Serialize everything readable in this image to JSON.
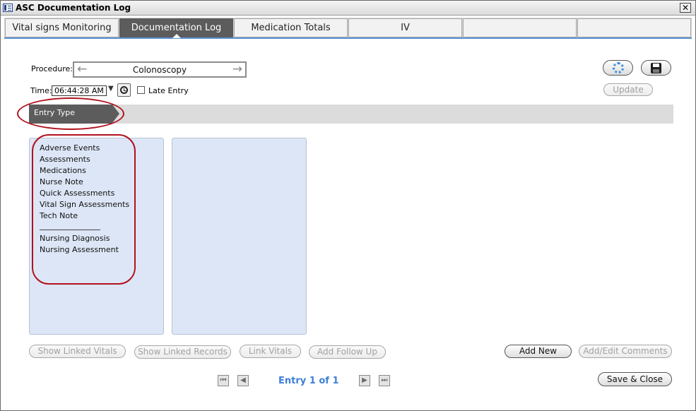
{
  "window": {
    "title": "ASC Documentation Log",
    "close_glyph": "✕"
  },
  "tabs": [
    {
      "label": "Vital signs Monitoring",
      "active": false
    },
    {
      "label": "Documentation Log",
      "active": true
    },
    {
      "label": "Medication Totals",
      "active": false
    },
    {
      "label": "IV",
      "active": false
    },
    {
      "label": "",
      "active": false
    },
    {
      "label": "",
      "active": false
    }
  ],
  "procedure": {
    "label": "Procedure:",
    "value": "Colonoscopy",
    "prev_icon": "arrow-left-icon",
    "next_icon": "arrow-right-icon"
  },
  "time": {
    "label": "Time:",
    "value": "06:44:28 AM",
    "late_entry_label": "Late Entry",
    "late_entry_checked": false
  },
  "top_buttons": {
    "refresh_icon": "spinner-icon",
    "save_icon": "floppy-disk-icon",
    "update_label": "Update"
  },
  "entry_type": {
    "label": "Entry Type"
  },
  "entry_list": {
    "group1": [
      "Adverse Events",
      "Assessments",
      "Medications",
      "Nurse Note",
      "Quick Assessments",
      "Vital Sign Assessments",
      "Tech Note"
    ],
    "group2": [
      "Nursing Diagnosis",
      "Nursing Assessment"
    ]
  },
  "bottom_buttons": {
    "show_linked_vitals": "Show Linked Vitals",
    "show_linked_records": "Show Linked Records",
    "link_vitals": "Link Vitals",
    "add_follow_up": "Add Follow Up",
    "add_new": "Add New",
    "add_edit_comments": "Add/Edit Comments",
    "save_close": "Save & Close"
  },
  "pager": {
    "text": "Entry 1 of 1",
    "first_glyph": "⏮",
    "prev_glyph": "◀",
    "next_glyph": "▶",
    "last_glyph": "⏭"
  },
  "annotation_color": "#b1121f"
}
